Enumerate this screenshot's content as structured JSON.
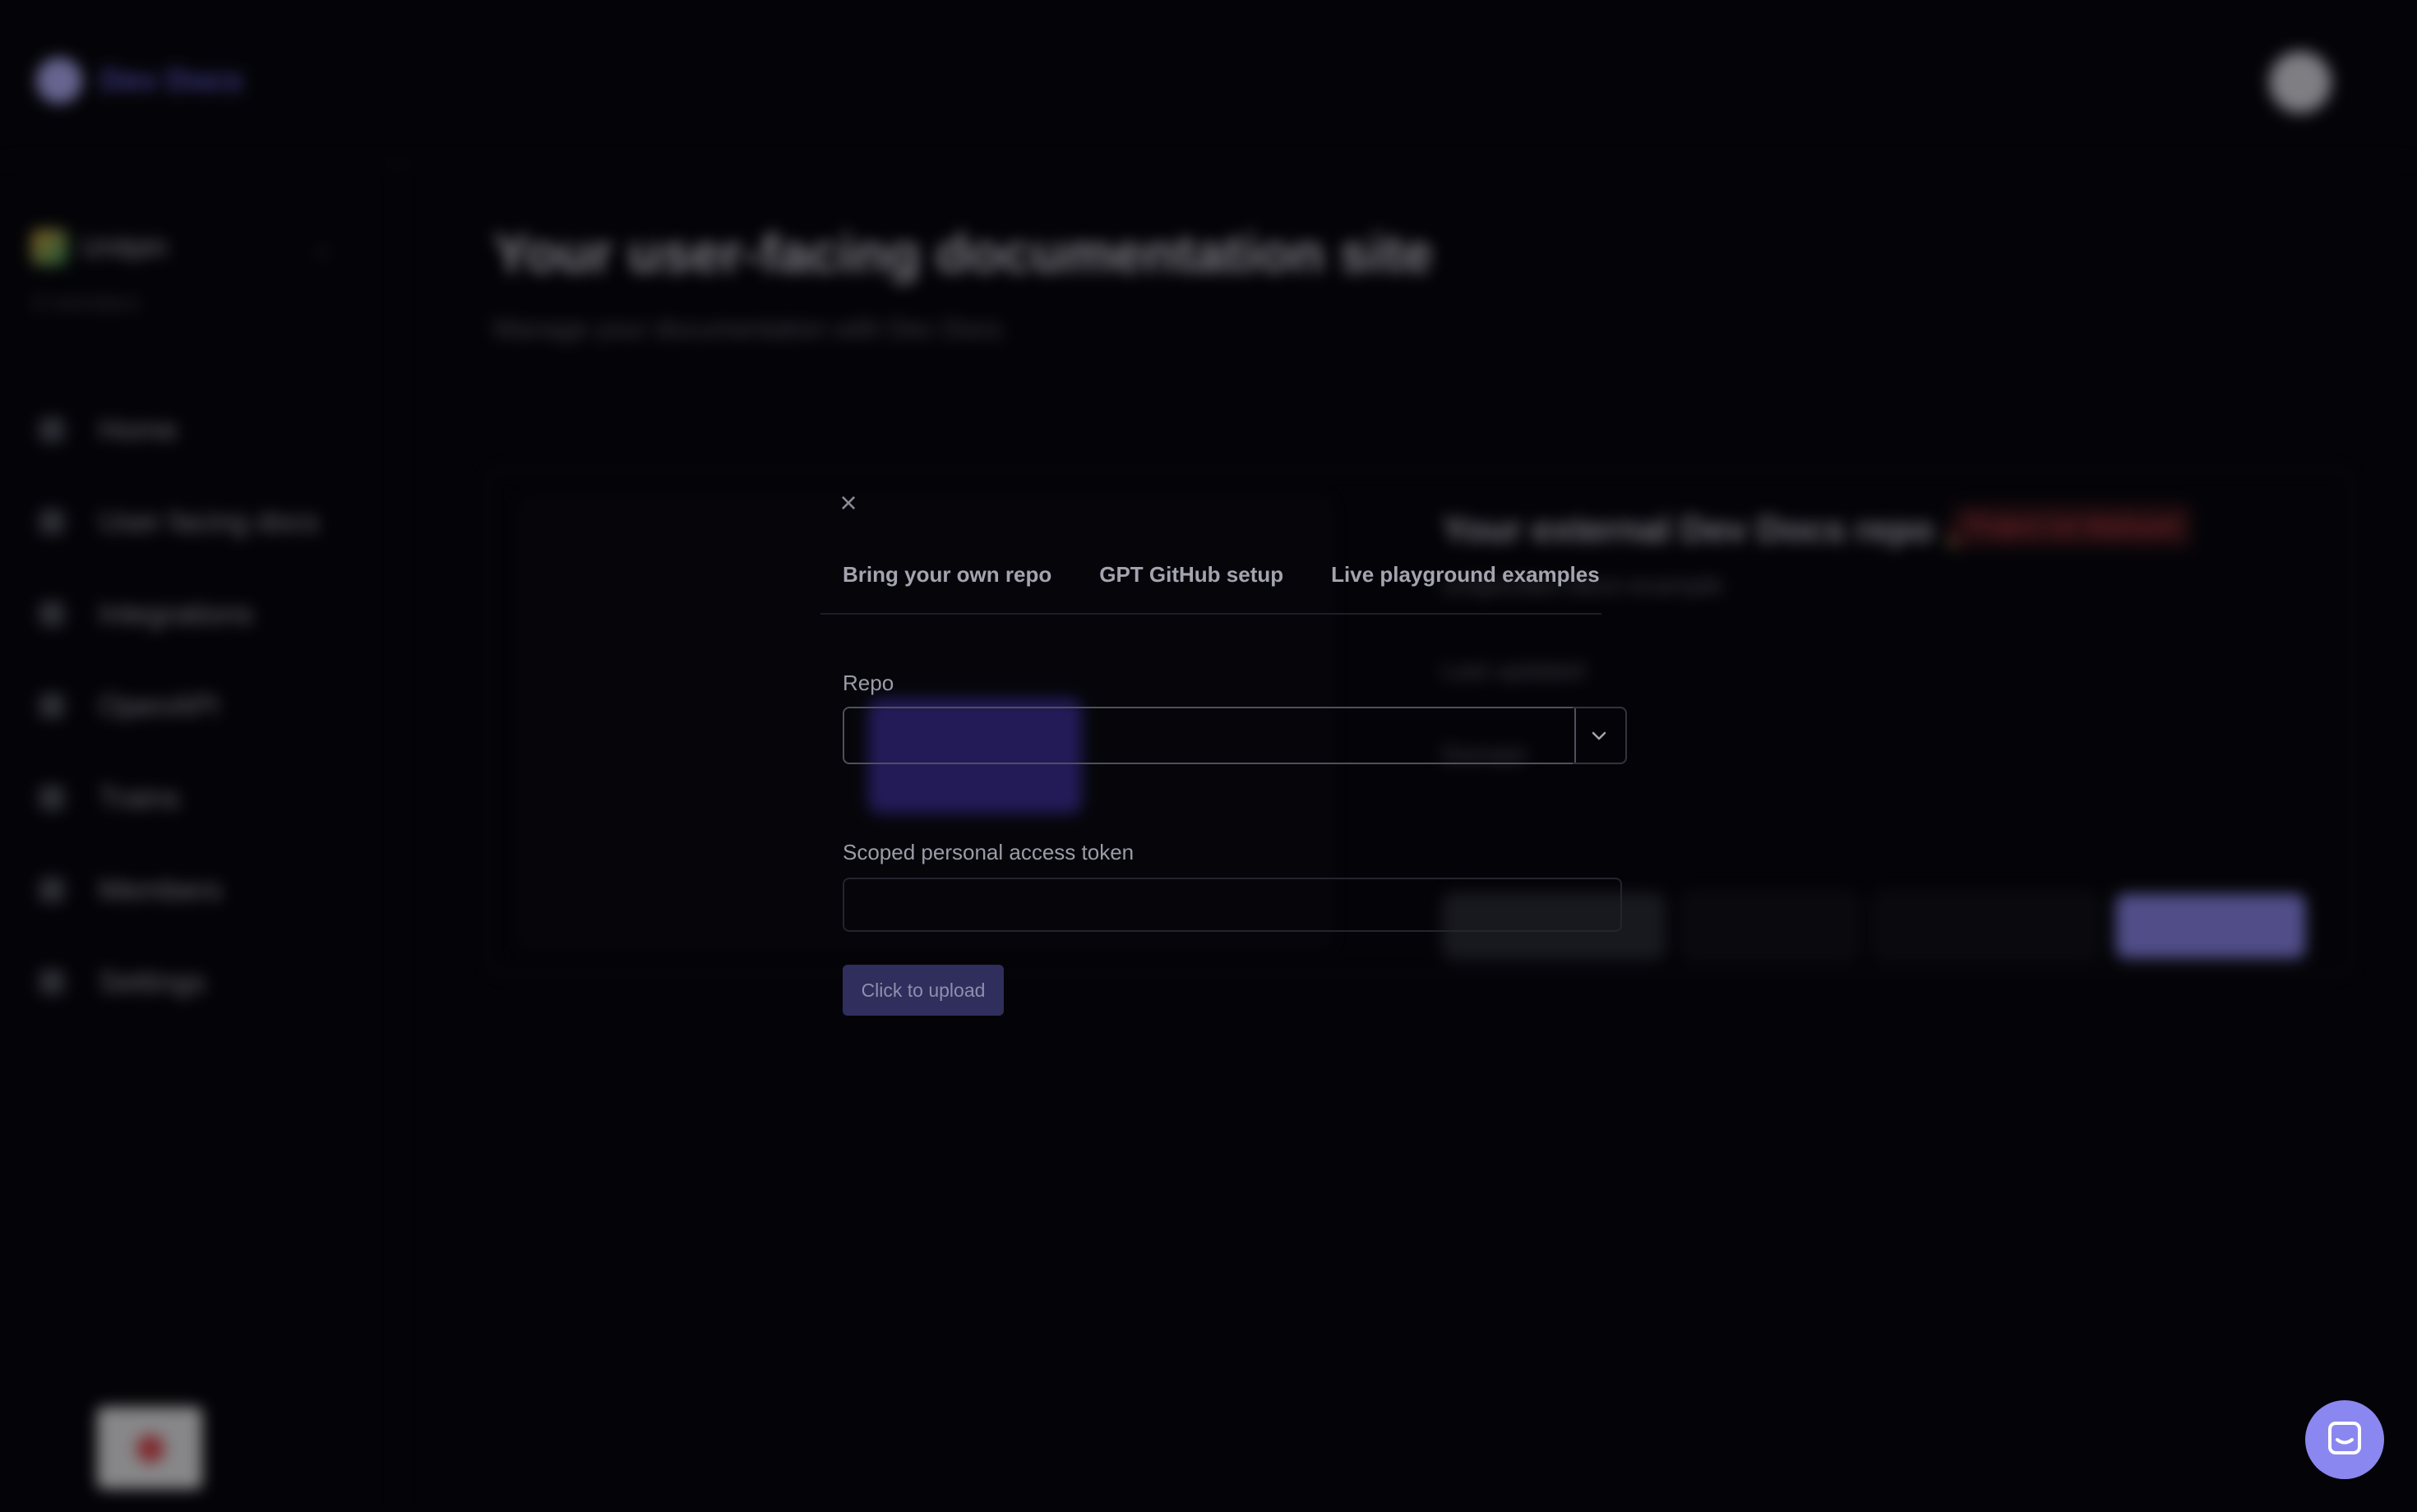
{
  "app": {
    "brand": "Dev Docs",
    "workspace_name": "Unitpin",
    "workspace_sub": "0 members",
    "nav": [
      "Home",
      "User facing docs",
      "Integrations",
      "OpenAPI",
      "Trains",
      "Members",
      "Settings"
    ],
    "page_title": "Your user-facing documentation site",
    "page_subtitle": "Manage your documentation with Dev Docs",
    "card": {
      "title": "Your external Dev Docs repo 🚀",
      "status_badge": "Project not deployed",
      "url": "unitpin/dev-docs-example",
      "last_updated_label": "Last updated",
      "domain_label": "Domain"
    }
  },
  "modal": {
    "tabs": [
      "Bring your own repo",
      "GPT GitHub setup",
      "Live playground examples"
    ],
    "repo_label": "Repo",
    "token_label": "Scoped personal access token",
    "token_value": "",
    "upload_label": "Click to upload"
  },
  "colors": {
    "accent": "#8b87f0",
    "error": "#e5484d",
    "background": "#040408"
  }
}
